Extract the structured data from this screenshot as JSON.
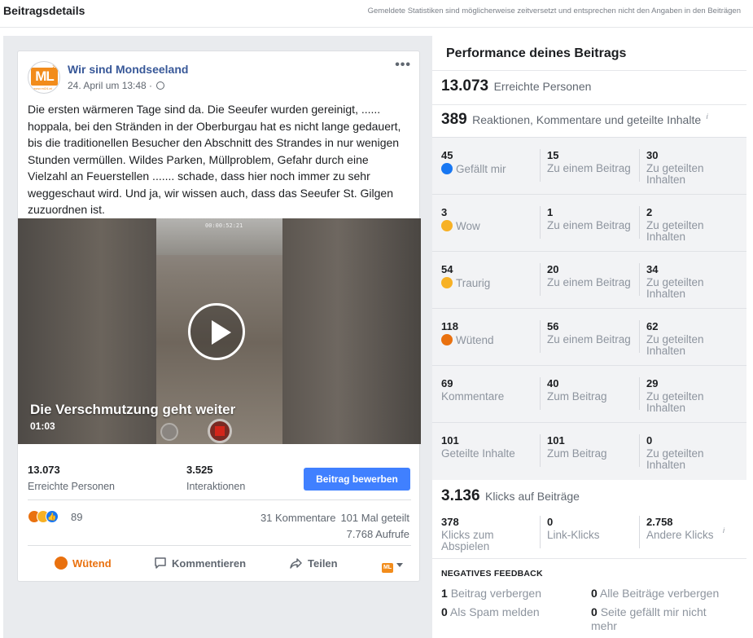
{
  "header": {
    "title": "Beitragsdetails",
    "note": "Gemeldete Statistiken sind möglicherweise zeitversetzt und entsprechen nicht den Angaben in den Beiträgen"
  },
  "post": {
    "page_name": "Wir sind Mondseeland",
    "avatar_text": "ML",
    "avatar_badge": "24",
    "avatar_sub": "www.ml24.at",
    "date": "24. April um 13:48 ·",
    "more_icon": "•••",
    "text": "Die ersten wärmeren Tage sind da. Die Seeufer wurden gereinigt, ...... hoppala, bei den Stränden in der Oberburgau hat es nicht lange gedauert, bis die traditionellen Besucher den Abschnitt des Strandes in nur wenigen Stunden vermüllen. Wildes Parken, Müllproblem, Gefahr durch eine Vielzahl an Feuerstellen ....... schade, dass hier noch immer zu sehr weggeschaut wird. Und ja, wir wissen auch, dass das Seeufer St. Gilgen zuzuordnen ist.",
    "video": {
      "title": "Die Verschmutzung geht weiter",
      "duration": "01:03",
      "timecode": "00:00:52:21"
    },
    "reach": {
      "value": "13.073",
      "label": "Erreichte Personen"
    },
    "interactions": {
      "value": "3.525",
      "label": "Interaktionen"
    },
    "boost_label": "Beitrag bewerben",
    "reaction_count": "89",
    "comments": "31 Kommentare",
    "shares": "101 Mal geteilt",
    "views": "7.768 Aufrufe",
    "actions": {
      "reaction": "Wütend",
      "comment": "Kommentieren",
      "share": "Teilen",
      "page_icon": "ML"
    }
  },
  "performance": {
    "title": "Performance deines Beitrags",
    "reach": {
      "value": "13.073",
      "label": "Erreichte Personen"
    },
    "engagement": {
      "value": "389",
      "label": "Reaktionen, Kommentare und geteilte Inhalte"
    },
    "rows": [
      {
        "total": "45",
        "label": "Gefällt mir",
        "icon": "like-icon",
        "post": "15",
        "post_label": "Zu einem Beitrag",
        "shared": "30",
        "shared_label": "Zu geteilten Inhalten"
      },
      {
        "total": "3",
        "label": "Wow",
        "icon": "wow-icon",
        "post": "1",
        "post_label": "Zu einem Beitrag",
        "shared": "2",
        "shared_label": "Zu geteilten Inhalten"
      },
      {
        "total": "54",
        "label": "Traurig",
        "icon": "sad-icon",
        "post": "20",
        "post_label": "Zu einem Beitrag",
        "shared": "34",
        "shared_label": "Zu geteilten Inhalten"
      },
      {
        "total": "118",
        "label": "Wütend",
        "icon": "angry-icon",
        "post": "56",
        "post_label": "Zu einem Beitrag",
        "shared": "62",
        "shared_label": "Zu geteilten Inhalten"
      },
      {
        "total": "69",
        "label": "Kommentare",
        "icon": "",
        "post": "40",
        "post_label": "Zum Beitrag",
        "shared": "29",
        "shared_label": "Zu geteilten Inhalten"
      },
      {
        "total": "101",
        "label": "Geteilte Inhalte",
        "icon": "",
        "post": "101",
        "post_label": "Zum Beitrag",
        "shared": "0",
        "shared_label": "Zu geteilten Inhalten"
      }
    ],
    "clicks": {
      "value": "3.136",
      "label": "Klicks auf Beiträge"
    },
    "click_breakdown": [
      {
        "value": "378",
        "label": "Klicks zum Abspielen"
      },
      {
        "value": "0",
        "label": "Link-Klicks"
      },
      {
        "value": "2.758",
        "label": "Andere Klicks"
      }
    ],
    "negative_title": "NEGATIVES FEEDBACK",
    "negative": [
      {
        "value": "1",
        "label": "Beitrag verbergen"
      },
      {
        "value": "0",
        "label": "Alle Beiträge verbergen"
      },
      {
        "value": "0",
        "label": "Als Spam melden"
      },
      {
        "value": "0",
        "label": "Seite gefällt mir nicht mehr"
      }
    ]
  },
  "colors": {
    "accent": "#4080ff",
    "link": "#385898",
    "angry": "#e9710f",
    "brand": "#f28c1b"
  }
}
